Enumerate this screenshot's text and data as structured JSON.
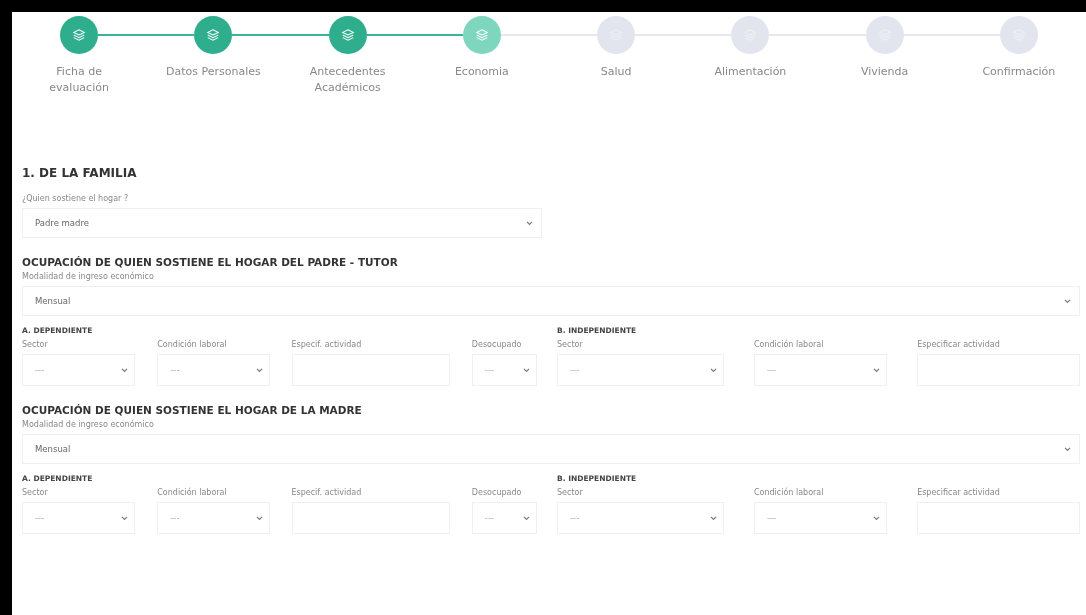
{
  "stepper": {
    "steps": [
      {
        "label": "Ficha de evaluación",
        "completed": true,
        "selected": false
      },
      {
        "label": "Datos Personales",
        "completed": true,
        "selected": false
      },
      {
        "label": "Antecedentes Académicos",
        "completed": true,
        "selected": false
      },
      {
        "label": "Economia",
        "completed": false,
        "selected": true
      },
      {
        "label": "Salud",
        "completed": false,
        "selected": false
      },
      {
        "label": "Alimentación",
        "completed": false,
        "selected": false
      },
      {
        "label": "Vivienda",
        "completed": false,
        "selected": false
      },
      {
        "label": "Confirmación",
        "completed": false,
        "selected": false
      }
    ]
  },
  "section_title": "1. DE LA FAMILIA",
  "household": {
    "label": "¿Quien sostiene el hogar ?",
    "value": "Padre madre"
  },
  "occupations": [
    {
      "title": "OCUPACIÓN DE QUIEN SOSTIENE EL HOGAR DEL PADRE - TUTOR",
      "income": {
        "label": "Modalidad de ingreso económico",
        "value": "Mensual"
      },
      "dependent": {
        "title": "A. DEPENDIENTE",
        "fields": [
          {
            "label": "Sector",
            "kind": "select",
            "placeholder": "---"
          },
          {
            "label": "Condición laboral",
            "kind": "select",
            "placeholder": "---"
          },
          {
            "label": "Especif. actividad",
            "kind": "text"
          },
          {
            "label": "Desocupado",
            "kind": "select",
            "placeholder": "---"
          }
        ]
      },
      "independent": {
        "title": "B. INDEPENDIENTE",
        "fields": [
          {
            "label": "Sector",
            "kind": "select",
            "placeholder": "---"
          },
          {
            "label": "Condición laboral",
            "kind": "select",
            "placeholder": "---"
          },
          {
            "label": "Especificar actividad",
            "kind": "text"
          }
        ]
      }
    },
    {
      "title": "OCUPACIÓN DE QUIEN SOSTIENE EL HOGAR DE LA MADRE",
      "income": {
        "label": "Modalidad de ingreso económico",
        "value": "Mensual"
      },
      "dependent": {
        "title": "A. DEPENDIENTE",
        "fields": [
          {
            "label": "Sector",
            "kind": "select",
            "placeholder": "---"
          },
          {
            "label": "Condición laboral",
            "kind": "select",
            "placeholder": "---"
          },
          {
            "label": "Especif. actividad",
            "kind": "text"
          },
          {
            "label": "Desocupado",
            "kind": "select",
            "placeholder": "---"
          }
        ]
      },
      "independent": {
        "title": "B. INDEPENDIENTE",
        "fields": [
          {
            "label": "Sector",
            "kind": "select",
            "placeholder": "---"
          },
          {
            "label": "Condición laboral",
            "kind": "select",
            "placeholder": "---"
          },
          {
            "label": "Especificar actividad",
            "kind": "text"
          }
        ]
      }
    }
  ]
}
